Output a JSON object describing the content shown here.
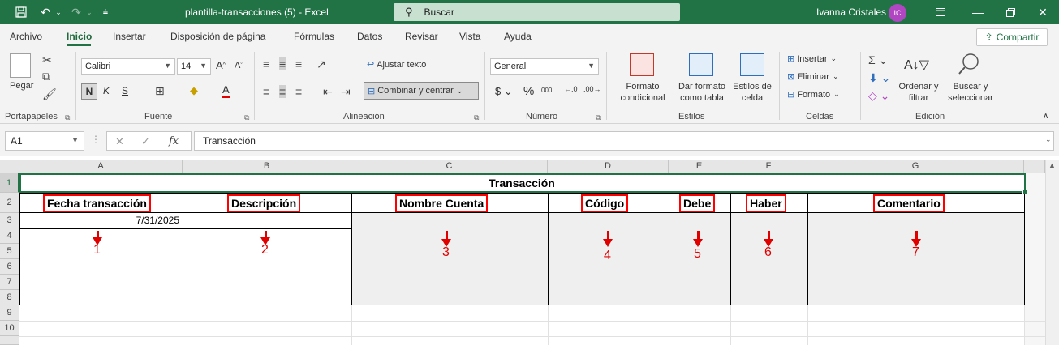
{
  "titlebar": {
    "document_title": "plantilla-transacciones (5)  -  Excel",
    "search_placeholder": "Buscar",
    "user_name": "Ivanna Cristales",
    "user_initials": "IC"
  },
  "menu": {
    "tabs": [
      "Archivo",
      "Inicio",
      "Insertar",
      "Disposición de página",
      "Fórmulas",
      "Datos",
      "Revisar",
      "Vista",
      "Ayuda"
    ],
    "active_tab": "Inicio",
    "share_label": "Compartir"
  },
  "ribbon": {
    "clipboard": {
      "paste_label": "Pegar",
      "group_label": "Portapapeles"
    },
    "font": {
      "font_name": "Calibri",
      "font_size": "14",
      "bold": "N",
      "italic": "K",
      "underline": "S",
      "group_label": "Fuente"
    },
    "alignment": {
      "wrap_text": "Ajustar texto",
      "merge_center": "Combinar y centrar",
      "group_label": "Alineación"
    },
    "number": {
      "format": "General",
      "group_label": "Número"
    },
    "styles": {
      "conditional_format": [
        "Formato",
        "condicional"
      ],
      "format_as_table": [
        "Dar formato",
        "como tabla"
      ],
      "cell_styles": [
        "Estilos de",
        "celda"
      ],
      "group_label": "Estilos"
    },
    "cells": {
      "insert": "Insertar",
      "delete": "Eliminar",
      "format": "Formato",
      "group_label": "Celdas"
    },
    "editing": {
      "sort_filter": [
        "Ordenar y",
        "filtrar"
      ],
      "find_select": [
        "Buscar y",
        "seleccionar"
      ],
      "group_label": "Edición"
    }
  },
  "formula_bar": {
    "name_box": "A1",
    "fx": "fx",
    "content": "Transacción"
  },
  "sheet": {
    "columns": [
      "A",
      "B",
      "C",
      "D",
      "E",
      "F",
      "G"
    ],
    "rows": [
      "1",
      "2",
      "3",
      "4",
      "5",
      "6",
      "7",
      "8",
      "9",
      "10"
    ],
    "title": "Transacción",
    "headers": [
      "Fecha transacción",
      "Descripción",
      "Nombre Cuenta",
      "Código",
      "Debe",
      "Haber",
      "Comentario"
    ],
    "date_value": "7/31/2025",
    "annotation_numbers": [
      "1",
      "2",
      "3",
      "4",
      "5",
      "6",
      "7"
    ]
  }
}
